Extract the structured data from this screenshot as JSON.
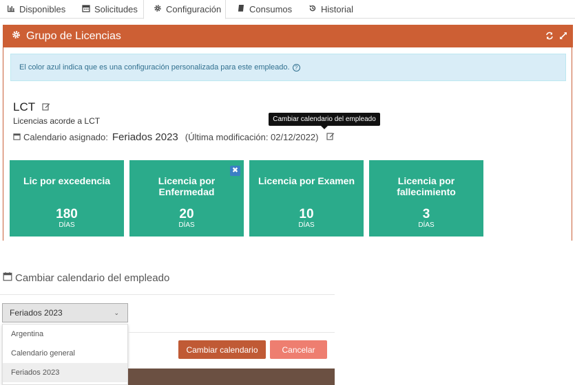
{
  "tabs": [
    {
      "label": "Disponibles",
      "icon": "bar-chart-icon"
    },
    {
      "label": "Solicitudes",
      "icon": "calendar-icon"
    },
    {
      "label": "Configuración",
      "icon": "gear-icon"
    },
    {
      "label": "Consumos",
      "icon": "book-icon"
    },
    {
      "label": "Historial",
      "icon": "history-icon"
    }
  ],
  "panel": {
    "title": "Grupo de Licencias",
    "header_color": "#cd5f34"
  },
  "info": {
    "text": "El color azul indica que es una configuración personalizada para este empleado."
  },
  "group": {
    "name": "LCT",
    "description": "Licencias acorde a LCT",
    "calendar_label": "Calendario asignado:",
    "calendar_name": "Feriados 2023",
    "modified": "(Última modificación: 02/12/2022)"
  },
  "tooltip": "Cambiar calendario del empleado",
  "cards": [
    {
      "title": "Lic por excedencia",
      "value": "180",
      "unit": "DÍAS"
    },
    {
      "title": "Licencia por Enfermedad",
      "value": "20",
      "unit": "DÍAS"
    },
    {
      "title": "Licencia por Examen",
      "value": "10",
      "unit": "DÍAS"
    },
    {
      "title": "Licencia por fallecimiento",
      "value": "3",
      "unit": "DÍAS"
    }
  ],
  "modal": {
    "title": "Cambiar calendario del empleado",
    "select_value": "Feriados 2023",
    "options": [
      "Argentina",
      "Calendario general",
      "Feriados 2023"
    ],
    "change_label": "Cambiar calendario",
    "cancel_label": "Cancelar"
  }
}
